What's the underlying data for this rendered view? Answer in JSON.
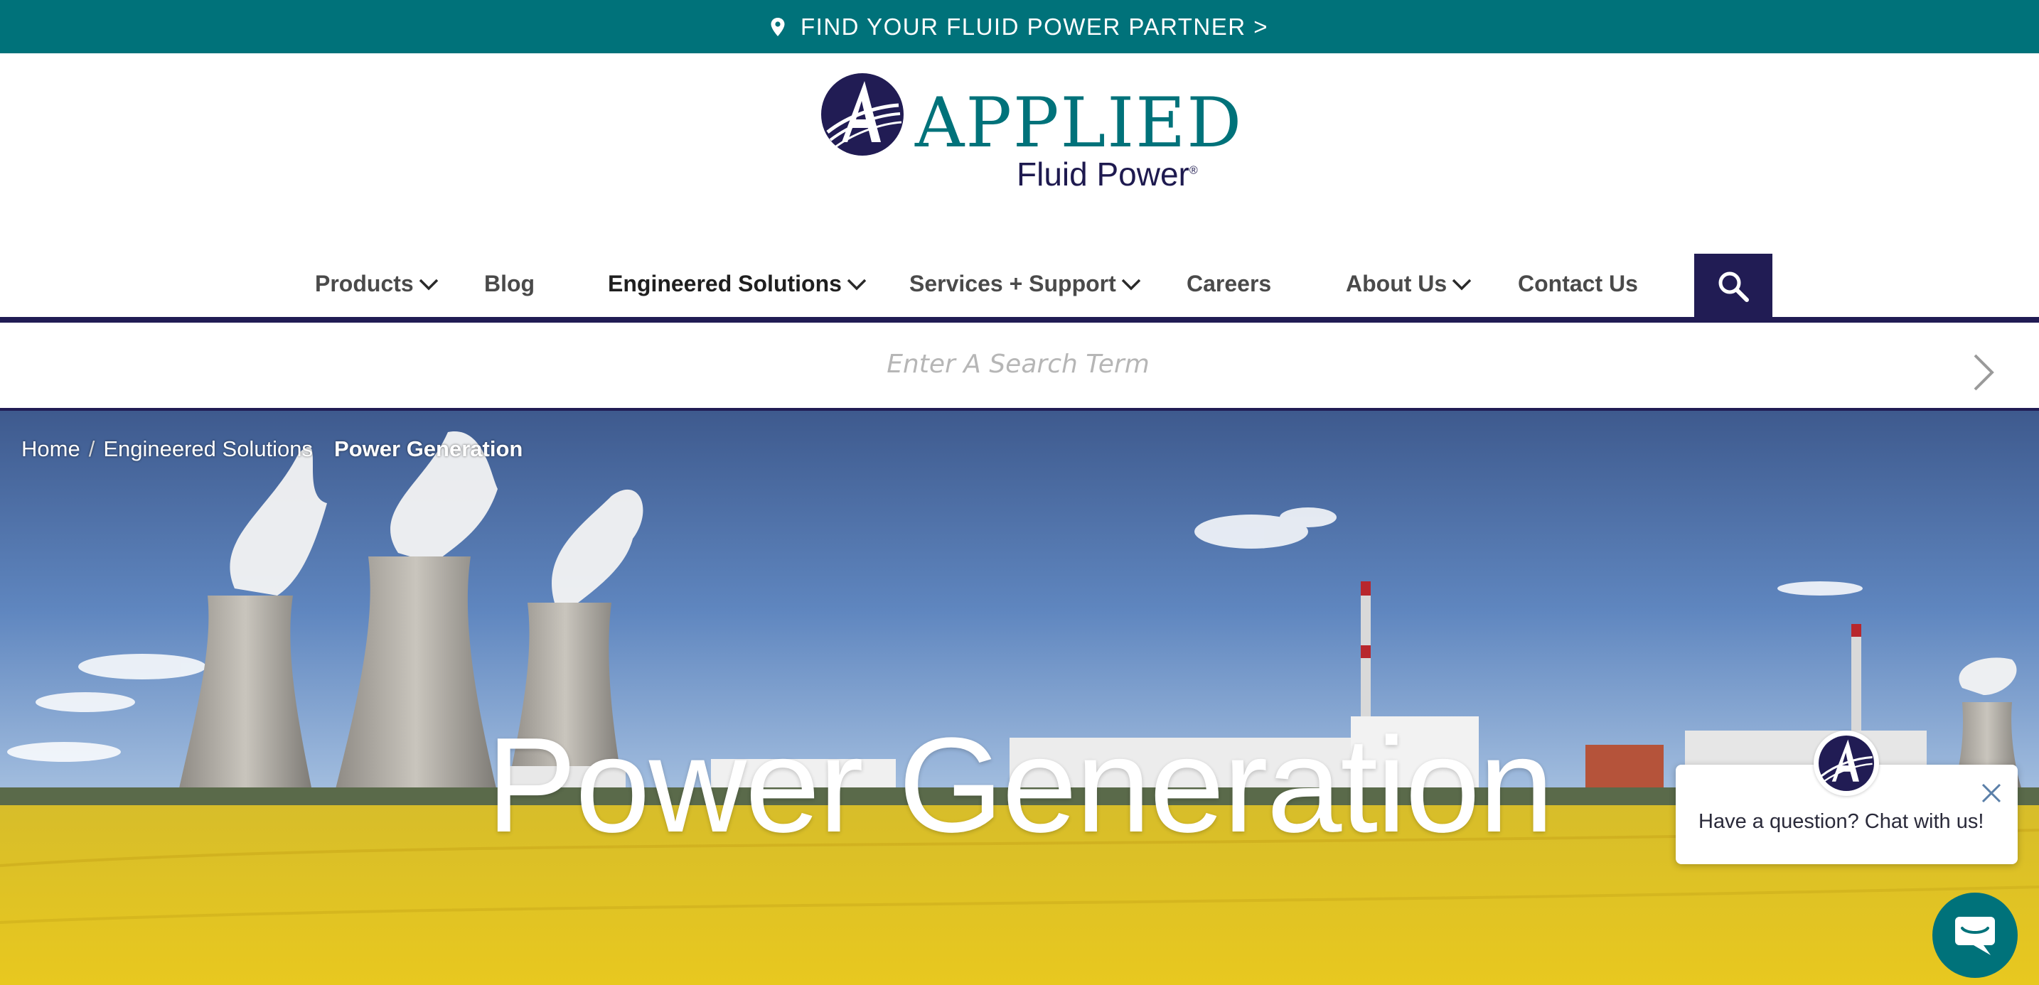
{
  "topbar": {
    "link_text": "FIND YOUR FLUID POWER PARTNER >",
    "icon": "location-pin-icon",
    "bg_color": "#00727a"
  },
  "logo": {
    "wordmark": "APPLIED",
    "subtitle": "Fluid Power",
    "trademark": "®",
    "brand_color": "#00727a",
    "secondary_color": "#1e1a4f"
  },
  "nav": {
    "items": [
      {
        "label": "Products",
        "dropdown": true
      },
      {
        "label": "Blog",
        "dropdown": false
      },
      {
        "label": "Engineered Solutions",
        "dropdown": true
      },
      {
        "label": "Services + Support",
        "dropdown": true
      },
      {
        "label": "Careers",
        "dropdown": false
      },
      {
        "label": "About Us",
        "dropdown": true
      },
      {
        "label": "Contact Us",
        "dropdown": false
      }
    ],
    "search_icon": "search-icon",
    "accent_color": "#211c54"
  },
  "search": {
    "placeholder": "Enter A Search Term",
    "submit_icon": "chevron-right-icon"
  },
  "breadcrumb": {
    "home": "Home",
    "separator": "/",
    "parent": "Engineered Solutions",
    "current": "Power Generation"
  },
  "hero": {
    "title": "Power Generation"
  },
  "chat": {
    "message": "Have a question? Chat with us!",
    "close_icon": "close-icon",
    "launcher_icon": "chat-bubble-icon"
  }
}
